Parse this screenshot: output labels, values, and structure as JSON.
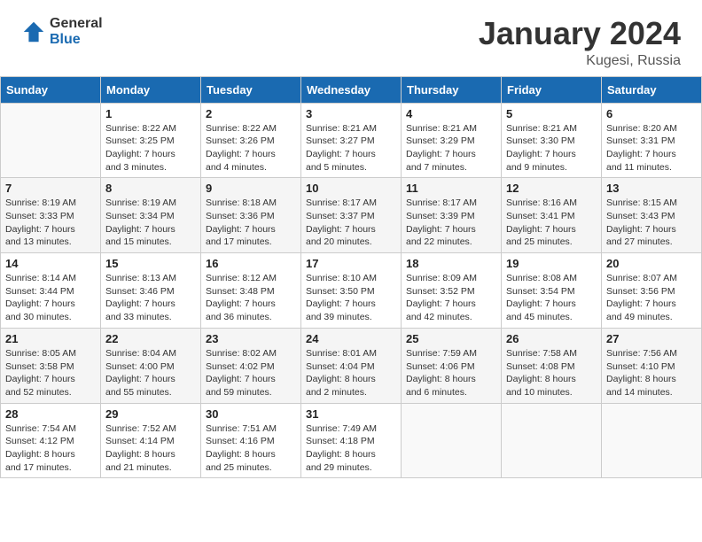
{
  "header": {
    "logo_general": "General",
    "logo_blue": "Blue",
    "month_title": "January 2024",
    "location": "Kugesi, Russia"
  },
  "weekdays": [
    "Sunday",
    "Monday",
    "Tuesday",
    "Wednesday",
    "Thursday",
    "Friday",
    "Saturday"
  ],
  "weeks": [
    [
      {
        "day": "",
        "info": ""
      },
      {
        "day": "1",
        "info": "Sunrise: 8:22 AM\nSunset: 3:25 PM\nDaylight: 7 hours\nand 3 minutes."
      },
      {
        "day": "2",
        "info": "Sunrise: 8:22 AM\nSunset: 3:26 PM\nDaylight: 7 hours\nand 4 minutes."
      },
      {
        "day": "3",
        "info": "Sunrise: 8:21 AM\nSunset: 3:27 PM\nDaylight: 7 hours\nand 5 minutes."
      },
      {
        "day": "4",
        "info": "Sunrise: 8:21 AM\nSunset: 3:29 PM\nDaylight: 7 hours\nand 7 minutes."
      },
      {
        "day": "5",
        "info": "Sunrise: 8:21 AM\nSunset: 3:30 PM\nDaylight: 7 hours\nand 9 minutes."
      },
      {
        "day": "6",
        "info": "Sunrise: 8:20 AM\nSunset: 3:31 PM\nDaylight: 7 hours\nand 11 minutes."
      }
    ],
    [
      {
        "day": "7",
        "info": ""
      },
      {
        "day": "8",
        "info": "Sunrise: 8:19 AM\nSunset: 3:34 PM\nDaylight: 7 hours\nand 15 minutes."
      },
      {
        "day": "9",
        "info": "Sunrise: 8:18 AM\nSunset: 3:36 PM\nDaylight: 7 hours\nand 17 minutes."
      },
      {
        "day": "10",
        "info": "Sunrise: 8:17 AM\nSunset: 3:37 PM\nDaylight: 7 hours\nand 20 minutes."
      },
      {
        "day": "11",
        "info": "Sunrise: 8:17 AM\nSunset: 3:39 PM\nDaylight: 7 hours\nand 22 minutes."
      },
      {
        "day": "12",
        "info": "Sunrise: 8:16 AM\nSunset: 3:41 PM\nDaylight: 7 hours\nand 25 minutes."
      },
      {
        "day": "13",
        "info": "Sunrise: 8:15 AM\nSunset: 3:43 PM\nDaylight: 7 hours\nand 27 minutes."
      }
    ],
    [
      {
        "day": "14",
        "info": ""
      },
      {
        "day": "15",
        "info": "Sunrise: 8:13 AM\nSunset: 3:46 PM\nDaylight: 7 hours\nand 33 minutes."
      },
      {
        "day": "16",
        "info": "Sunrise: 8:12 AM\nSunset: 3:48 PM\nDaylight: 7 hours\nand 36 minutes."
      },
      {
        "day": "17",
        "info": "Sunrise: 8:10 AM\nSunset: 3:50 PM\nDaylight: 7 hours\nand 39 minutes."
      },
      {
        "day": "18",
        "info": "Sunrise: 8:09 AM\nSunset: 3:52 PM\nDaylight: 7 hours\nand 42 minutes."
      },
      {
        "day": "19",
        "info": "Sunrise: 8:08 AM\nSunset: 3:54 PM\nDaylight: 7 hours\nand 45 minutes."
      },
      {
        "day": "20",
        "info": "Sunrise: 8:07 AM\nSunset: 3:56 PM\nDaylight: 7 hours\nand 49 minutes."
      }
    ],
    [
      {
        "day": "21",
        "info": ""
      },
      {
        "day": "22",
        "info": "Sunrise: 8:04 AM\nSunset: 4:00 PM\nDaylight: 7 hours\nand 55 minutes."
      },
      {
        "day": "23",
        "info": "Sunrise: 8:02 AM\nSunset: 4:02 PM\nDaylight: 7 hours\nand 59 minutes."
      },
      {
        "day": "24",
        "info": "Sunrise: 8:01 AM\nSunset: 4:04 PM\nDaylight: 8 hours\nand 2 minutes."
      },
      {
        "day": "25",
        "info": "Sunrise: 7:59 AM\nSunset: 4:06 PM\nDaylight: 8 hours\nand 6 minutes."
      },
      {
        "day": "26",
        "info": "Sunrise: 7:58 AM\nSunset: 4:08 PM\nDaylight: 8 hours\nand 10 minutes."
      },
      {
        "day": "27",
        "info": "Sunrise: 7:56 AM\nSunset: 4:10 PM\nDaylight: 8 hours\nand 14 minutes."
      }
    ],
    [
      {
        "day": "28",
        "info": "Sunrise: 7:54 AM\nSunset: 4:12 PM\nDaylight: 8 hours\nand 17 minutes."
      },
      {
        "day": "29",
        "info": "Sunrise: 7:52 AM\nSunset: 4:14 PM\nDaylight: 8 hours\nand 21 minutes."
      },
      {
        "day": "30",
        "info": "Sunrise: 7:51 AM\nSunset: 4:16 PM\nDaylight: 8 hours\nand 25 minutes."
      },
      {
        "day": "31",
        "info": "Sunrise: 7:49 AM\nSunset: 4:18 PM\nDaylight: 8 hours\nand 29 minutes."
      },
      {
        "day": "",
        "info": ""
      },
      {
        "day": "",
        "info": ""
      },
      {
        "day": "",
        "info": ""
      }
    ]
  ],
  "week1_sun_info": "Sunrise: 8:19 AM\nSunset: 3:33 PM\nDaylight: 7 hours\nand 13 minutes.",
  "week3_sun_info": "Sunrise: 8:14 AM\nSunset: 3:44 PM\nDaylight: 7 hours\nand 30 minutes.",
  "week4_sun_info": "Sunrise: 8:05 AM\nSunset: 3:58 PM\nDaylight: 7 hours\nand 52 minutes."
}
